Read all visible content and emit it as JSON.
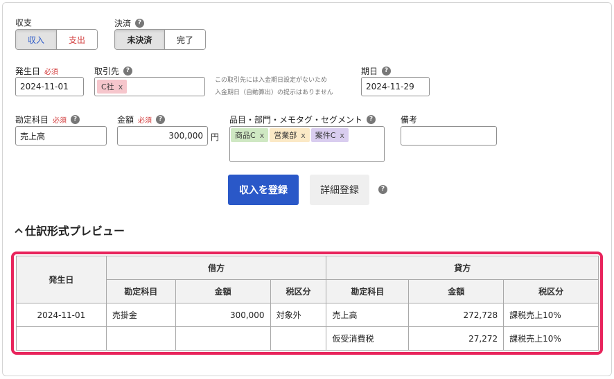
{
  "type_section": {
    "label": "収支",
    "options": [
      "収入",
      "支出"
    ],
    "selected": "収入",
    "colors": {
      "income": "#2a58c8",
      "expense": "#d23a3a"
    }
  },
  "settlement": {
    "label": "決済",
    "options": [
      "未決済",
      "完了"
    ],
    "selected": "未決済"
  },
  "date_field": {
    "label": "発生日",
    "required": "必須",
    "value": "2024-11-01"
  },
  "partner_field": {
    "label": "取引先",
    "tag": "C社",
    "tag_color": "#f6c6cc"
  },
  "partner_note": {
    "line1": "この取引先には入金期日設定がないため",
    "line2": "入金期日（自動算出）の提示はありません"
  },
  "due_field": {
    "label": "期日",
    "value": "2024-11-29"
  },
  "account_field": {
    "label": "勘定科目",
    "required": "必須",
    "value": "売上高"
  },
  "amount_field": {
    "label": "金額",
    "required": "必須",
    "value": "300,000",
    "unit": "円"
  },
  "tags_field": {
    "label": "品目・部門・メモタグ・セグメント",
    "tags": [
      {
        "text": "商品C",
        "color": "#cfe8c3"
      },
      {
        "text": "営業部",
        "color": "#fbe9c6"
      },
      {
        "text": "案件C",
        "color": "#d9cdef"
      }
    ]
  },
  "memo_field": {
    "label": "備考",
    "value": ""
  },
  "actions": {
    "register": "収入を登録",
    "detail": "詳細登録"
  },
  "preview": {
    "title": "仕訳形式プレビュー",
    "headers": {
      "date": "発生日",
      "debit": "借方",
      "credit": "貸方",
      "account": "勘定科目",
      "amount": "金額",
      "tax": "税区分"
    },
    "rows": [
      {
        "date": "2024-11-01",
        "d_account": "売掛金",
        "d_amount": "300,000",
        "d_tax": "対象外",
        "c_account": "売上高",
        "c_amount": "272,728",
        "c_tax": "課税売上10%"
      },
      {
        "date": "",
        "d_account": "",
        "d_amount": "",
        "d_tax": "",
        "c_account": "仮受消費税",
        "c_amount": "27,272",
        "c_tax": "課税売上10%"
      }
    ],
    "highlight_color": "#e8245c"
  }
}
